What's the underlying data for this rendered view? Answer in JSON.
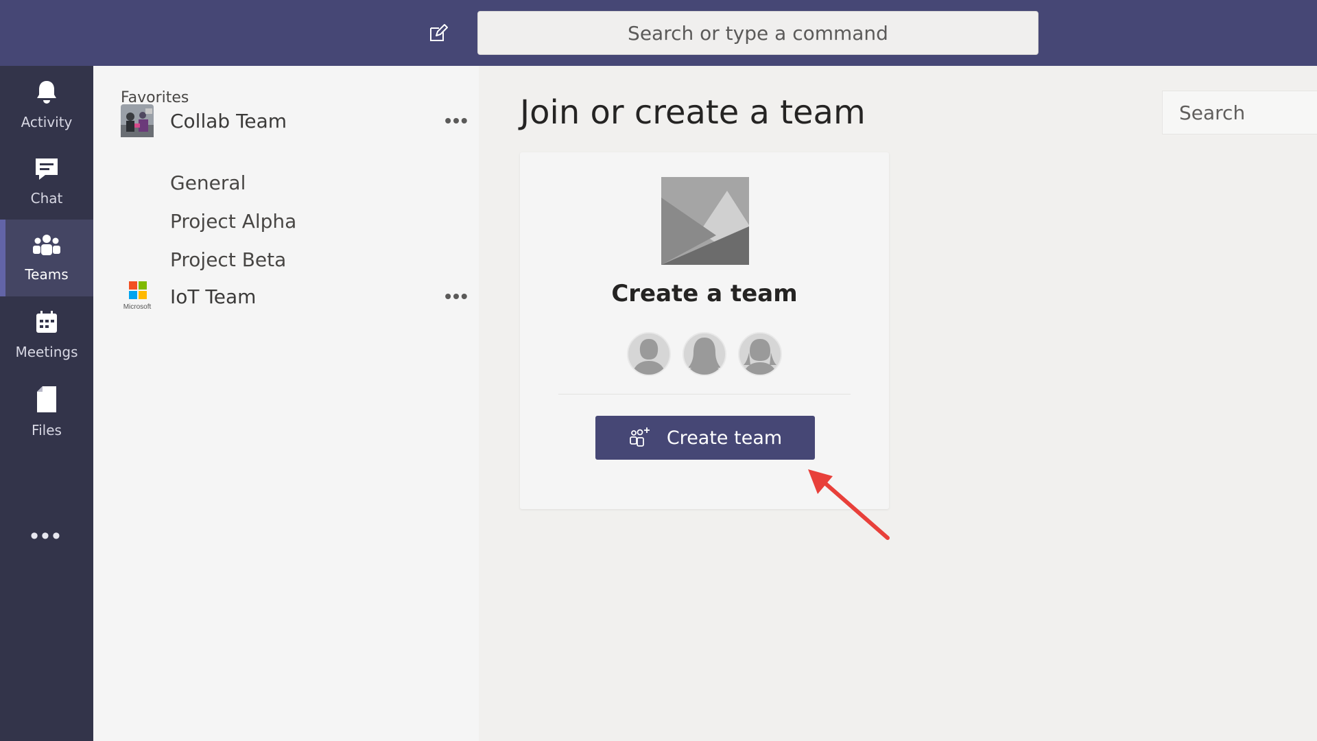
{
  "topbar": {
    "command_placeholder": "Search or type a command"
  },
  "rail": {
    "items": [
      {
        "label": "Activity",
        "icon": "bell-icon"
      },
      {
        "label": "Chat",
        "icon": "chat-icon"
      },
      {
        "label": "Teams",
        "icon": "teams-icon",
        "active": true
      },
      {
        "label": "Meetings",
        "icon": "calendar-icon"
      },
      {
        "label": "Files",
        "icon": "file-icon"
      }
    ],
    "more": "•••"
  },
  "sidebar": {
    "favorites_label": "Favorites",
    "teams": [
      {
        "name": "Collab Team",
        "avatar": "team-photo",
        "more": "•••",
        "channels": [
          "General",
          "Project Alpha",
          "Project Beta"
        ]
      },
      {
        "name": "IoT Team",
        "avatar": "microsoft-logo",
        "avatar_text": "Microsoft",
        "more": "•••",
        "channels": []
      }
    ]
  },
  "main": {
    "title": "Join or create a team",
    "search_placeholder": "Search",
    "card": {
      "title": "Create a team",
      "button_label": "Create team",
      "button_icon": "add-team-icon"
    }
  },
  "colors": {
    "brand": "#464775",
    "rail": "#33344a",
    "annotation_arrow": "#e8403a"
  }
}
